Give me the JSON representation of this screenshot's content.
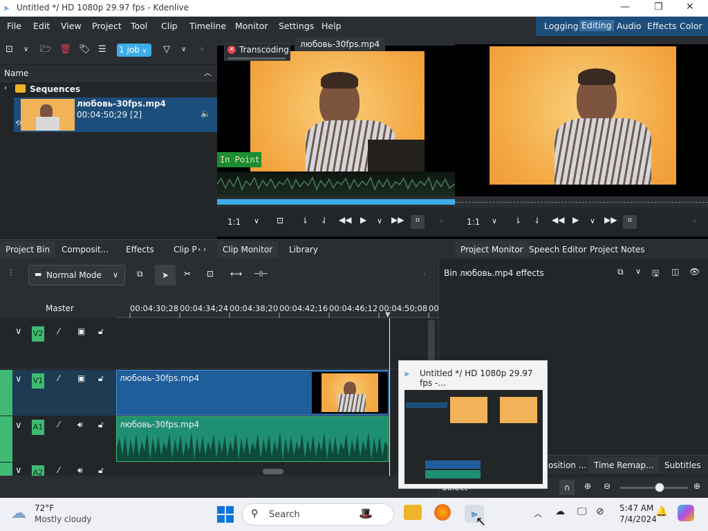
{
  "window": {
    "title": "Untitled */ HD 1080p 29.97 fps - Kdenlive"
  },
  "menu": [
    "File",
    "Edit",
    "View",
    "Project",
    "Tool",
    "Clip",
    "Timeline",
    "Monitor",
    "Settings",
    "Help"
  ],
  "workspaces": [
    "Logging",
    "Editing",
    "Audio",
    "Effects",
    "Color"
  ],
  "workspace_active": "Editing",
  "bin": {
    "jobs_label": "1 job",
    "column_name": "Name",
    "folder": "Sequences",
    "clip_name": "любовь-30fps.mp4",
    "clip_duration": "00:04:50;29 [2]",
    "tabs": [
      "Project Bin",
      "Composit...",
      "Effects",
      "Clip P"
    ]
  },
  "clip_monitor": {
    "transcoding": "Transcoding",
    "clip_tab": "любовь-30fps.mp4",
    "in_point": "In Point",
    "zoom": "1:1",
    "tabs": [
      "Clip Monitor",
      "Library"
    ]
  },
  "project_monitor": {
    "zoom": "1:1",
    "tabs": [
      "Project Monitor",
      "Speech Editor",
      "Project Notes"
    ]
  },
  "timeline": {
    "mode": "Normal Mode",
    "master": "Master",
    "ruler": [
      "00:04:30;28",
      "00:04:34;24",
      "00:04:38;20",
      "00:04:42;16",
      "00:04:46;12",
      "00:04:50;08",
      "00:0"
    ],
    "tracks": [
      {
        "name": "V2"
      },
      {
        "name": "V1"
      },
      {
        "name": "A1"
      },
      {
        "name": "A2"
      }
    ],
    "video_clip": "любовь-30fps.mp4",
    "audio_clip": "любовь-30fps.mp4"
  },
  "effects_panel": {
    "title": "Bin любовь.mp4 effects",
    "tabs": [
      "osition ...",
      "Time Remap...",
      "Subtitles"
    ]
  },
  "status": {
    "select": "Select"
  },
  "thumbnail_popup": {
    "title": "Untitled */ HD 1080p 29.97 fps -..."
  },
  "taskbar": {
    "weather_temp": "72°F",
    "weather_desc": "Mostly cloudy",
    "search_placeholder": "Search",
    "time": "5:47 AM",
    "date": "7/4/2024"
  },
  "colors": {
    "accent": "#3daee9",
    "selection": "#1d4e7b",
    "track_green": "#3fba73",
    "audio_clip": "#1f8f73",
    "video_clip": "#1f5d9b"
  }
}
